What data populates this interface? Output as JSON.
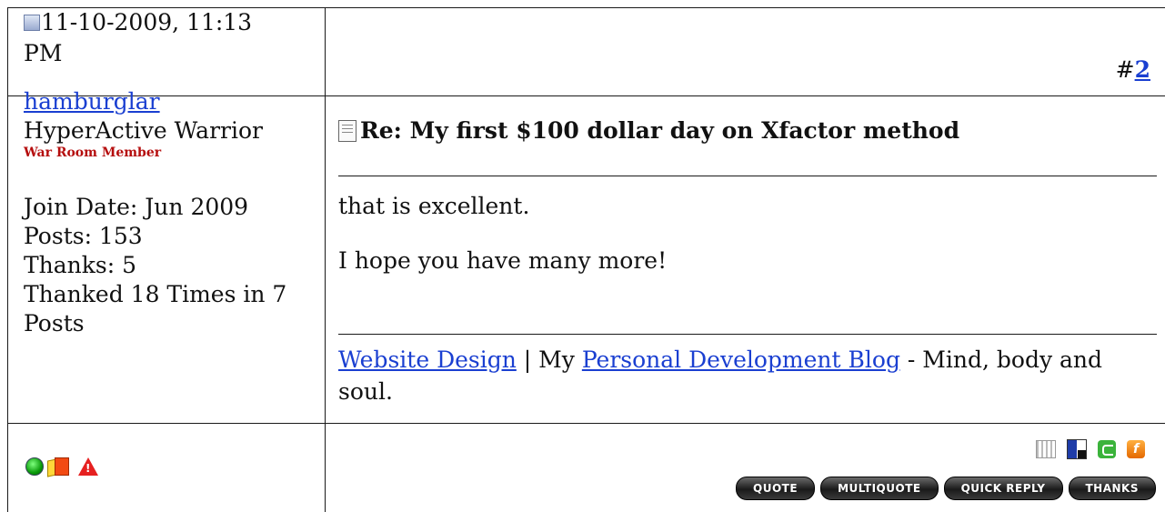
{
  "post": {
    "date": "11-10-2009, 11:13 PM",
    "number_prefix": "#",
    "number": "2"
  },
  "user": {
    "name": "hamburglar",
    "title": "HyperActive Warrior",
    "rank": "War Room Member",
    "join_date": "Join Date: Jun 2009",
    "posts": "Posts: 153",
    "thanks": "Thanks: 5",
    "thanked": "Thanked 18 Times in 7 Posts"
  },
  "message": {
    "title": "Re: My first $100 dollar day on Xfactor method",
    "lines": [
      "that is excellent.",
      "I hope you have many more!"
    ]
  },
  "signature": {
    "link1": "Website Design",
    "sep1": " | My ",
    "link2": "Personal Development Blog",
    "rest": " - Mind, body and soul."
  },
  "status_icons": [
    "online-status-icon",
    "reputation-icon",
    "report-post-icon"
  ],
  "social_icons": [
    "digg-icon",
    "delicious-icon",
    "stumbleupon-icon",
    "furl-icon"
  ],
  "buttons": {
    "quote": "QUOTE",
    "multiquote": "MULTIQUOTE",
    "quick_reply": "QUICK REPLY",
    "thanks": "THANKS"
  }
}
